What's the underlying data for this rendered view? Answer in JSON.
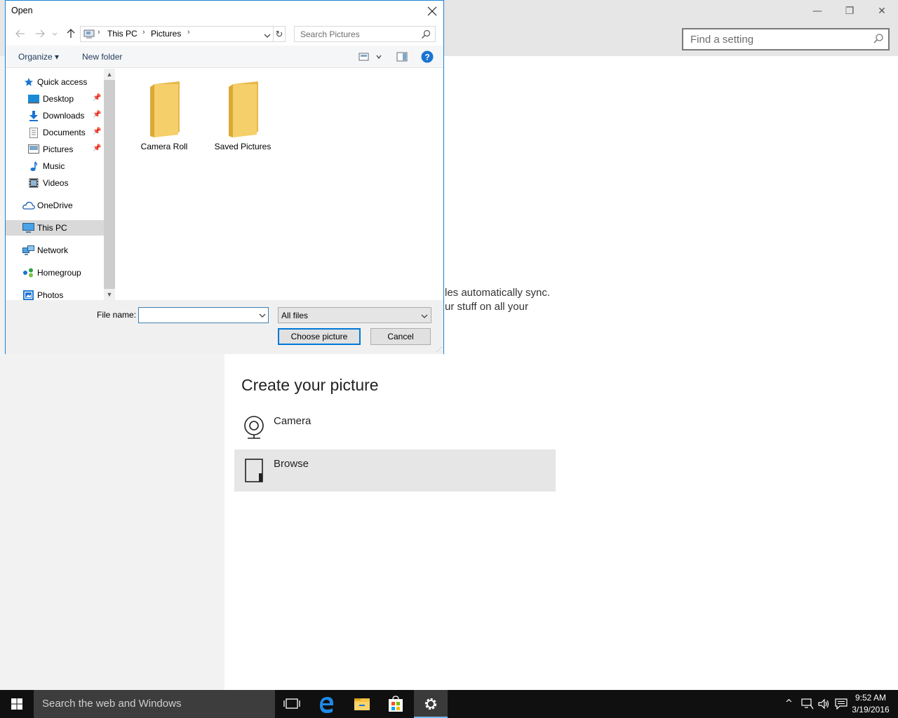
{
  "settings": {
    "search_placeholder": "Find a setting",
    "window_controls": {
      "minimize": "—",
      "restore": "❐",
      "close": "✕"
    },
    "sync_text_line1": "les automatically sync.",
    "sync_text_line2": "ur stuff on all your",
    "create_title": "Create your picture",
    "create_items": [
      {
        "label": "Camera"
      },
      {
        "label": "Browse"
      }
    ]
  },
  "dialog": {
    "title": "Open",
    "address": {
      "segments": [
        "This PC",
        "Pictures"
      ]
    },
    "search_placeholder": "Search Pictures",
    "commands": {
      "organize": "Organize ▾",
      "new_folder": "New folder"
    },
    "nav_items": [
      {
        "label": "Quick access",
        "icon": "star-icon",
        "pinned": false
      },
      {
        "label": "Desktop",
        "icon": "desktop-icon",
        "pinned": true
      },
      {
        "label": "Downloads",
        "icon": "downloads-icon",
        "pinned": true
      },
      {
        "label": "Documents",
        "icon": "documents-icon",
        "pinned": true
      },
      {
        "label": "Pictures",
        "icon": "pictures-icon",
        "pinned": true
      },
      {
        "label": "Music",
        "icon": "music-icon",
        "pinned": false
      },
      {
        "label": "Videos",
        "icon": "videos-icon",
        "pinned": false
      },
      {
        "label": "OneDrive",
        "icon": "onedrive-icon",
        "pinned": false
      },
      {
        "label": "This PC",
        "icon": "computer-icon",
        "pinned": false,
        "selected": true
      },
      {
        "label": "Network",
        "icon": "network-icon",
        "pinned": false
      },
      {
        "label": "Homegroup",
        "icon": "homegroup-icon",
        "pinned": false
      },
      {
        "label": "Photos",
        "icon": "photos-icon",
        "pinned": false
      }
    ],
    "folders": [
      {
        "label": "Camera Roll"
      },
      {
        "label": "Saved Pictures"
      }
    ],
    "file_name_label": "File name:",
    "file_name_value": "",
    "file_type": "All files",
    "choose_button": "Choose picture",
    "cancel_button": "Cancel"
  },
  "taskbar": {
    "search_placeholder": "Search the web and Windows",
    "time": "9:52 AM",
    "date": "3/19/2016",
    "accent": "#76b9ed"
  }
}
